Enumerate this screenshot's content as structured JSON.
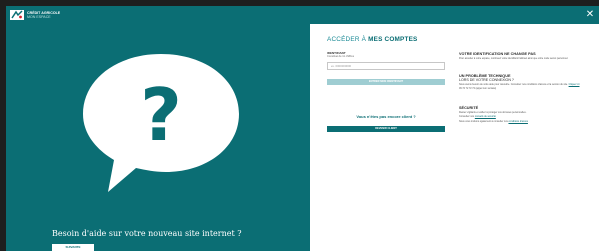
{
  "header": {
    "logo_line1": "CRÉDIT AGRICOLE",
    "logo_line2": "MON ESPACE",
    "close_icon": "close-icon"
  },
  "help_panel": {
    "icon": "question-bubble-icon",
    "title": "Besoin d'aide sur votre nouveau site internet ?",
    "button_label": "SUIVANTE"
  },
  "login": {
    "title_prefix": "ACCÉDER À",
    "title_strong": "MES COMPTES",
    "id_label": "IDENTIFIANT",
    "id_hint": "Constitué de 11 chiffres",
    "id_placeholder": "ex. 0000000000",
    "submit_label": "ENTRER MON IDENTIFIANT",
    "not_client_text": "Vous n'êtes pas encore client ?",
    "become_client_label": "DEVENIR CLIENT"
  },
  "info": {
    "section1_title": "VOTRE IDENTIFICATION NE CHANGE PAS",
    "section1_text": "Pour accéder à votre espace, continuez votre identifiant habituel ainsi que votre code secret personnel.",
    "section2_title": "UN PROBLÈME TECHNIQUE",
    "section2_subtitle": "LORS DE VOTRE CONNEXION ?",
    "section2_text": "Nous avons besoin de votre aide pour résoudre. Consultez nos conditions d'accès et la version du site.",
    "section2_link": "Cliquez ici",
    "section2_phone": "09 72 72 72 72 (appel non surtaxé)",
    "section3_title": "SÉCURITÉ",
    "section3_text": "Restez vigilants et veillez à protéger vos données personnelles.",
    "section3_link": "conseils de sécurité",
    "section3_text2": "Consultez nos",
    "section3_more": "Nous vous invitons également à consulter nos",
    "section3_link2": "conditions d'accès",
    "colors": {
      "brand": "#0b6e74",
      "accent": "#1a8a95"
    }
  }
}
